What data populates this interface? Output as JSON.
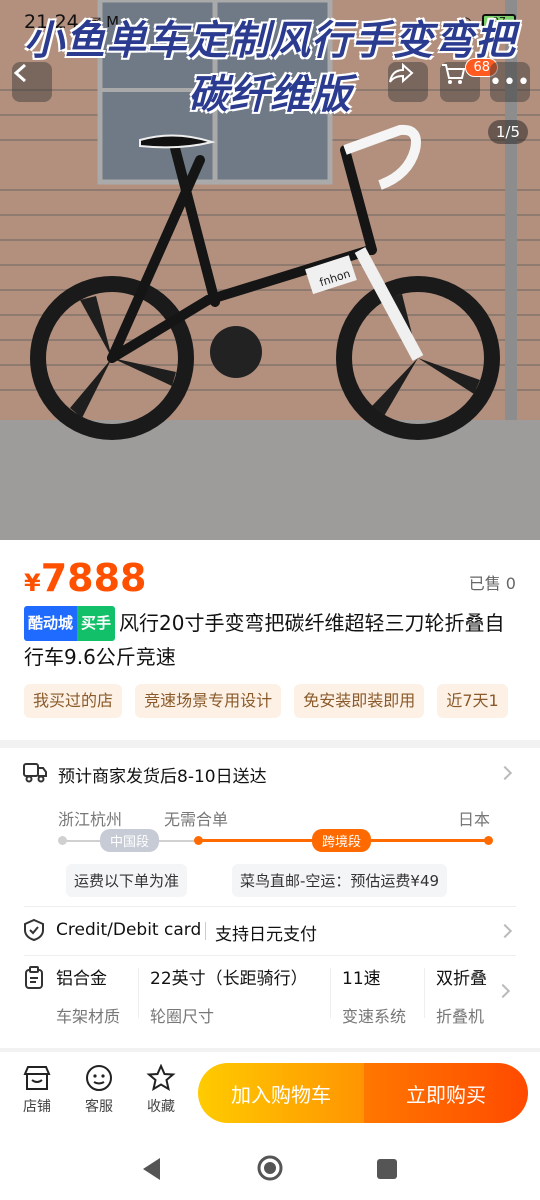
{
  "status_bar": {
    "time": "21:24",
    "indicators": "✉ M",
    "battery": "97"
  },
  "hero": {
    "overlay_title": "小鱼单车定制风行手变弯把碳纤维版",
    "image_counter": "1/5",
    "frame_brand": "fnhon",
    "cart_badge": "68"
  },
  "price": {
    "currency": "¥",
    "amount": "7888",
    "sold": "已售 0"
  },
  "product": {
    "badge_brand": "酷动城",
    "badge_hot": "买手",
    "title": "风行20寸手变弯把碳纤维超轻三刀轮折叠自行车9.6公斤竞速"
  },
  "chips": [
    "我买过的店",
    "竞速场景专用设计",
    "免安装即装即用",
    "近7天1"
  ],
  "shipping": {
    "eta": "预计商家发货后8-10日送达",
    "origin": "浙江杭州",
    "merge": "无需合单",
    "destination": "日本",
    "segment_cn": "中国段",
    "segment_cross": "跨境段",
    "note_cn": "运费以下单为准",
    "note_cross": "菜鸟直邮-空运：预估运费¥49"
  },
  "payment": {
    "method": "Credit/Debit card",
    "desc": "支持日元支付"
  },
  "specs": [
    {
      "value": "铝合金",
      "label": "车架材质"
    },
    {
      "value": "22英寸（长距骑行）",
      "label": "轮圈尺寸"
    },
    {
      "value": "11速",
      "label": "变速系统"
    },
    {
      "value": "双折叠",
      "label": "折叠机"
    }
  ],
  "bottom_bar": {
    "tabs": [
      {
        "label": "店铺"
      },
      {
        "label": "客服"
      },
      {
        "label": "收藏"
      }
    ],
    "add_to_cart": "加入购物车",
    "buy_now": "立即购买"
  },
  "colors": {
    "accent": "#ff5000",
    "cart_gradient": "#ffcb00",
    "buy_gradient": "#ff4a00"
  }
}
